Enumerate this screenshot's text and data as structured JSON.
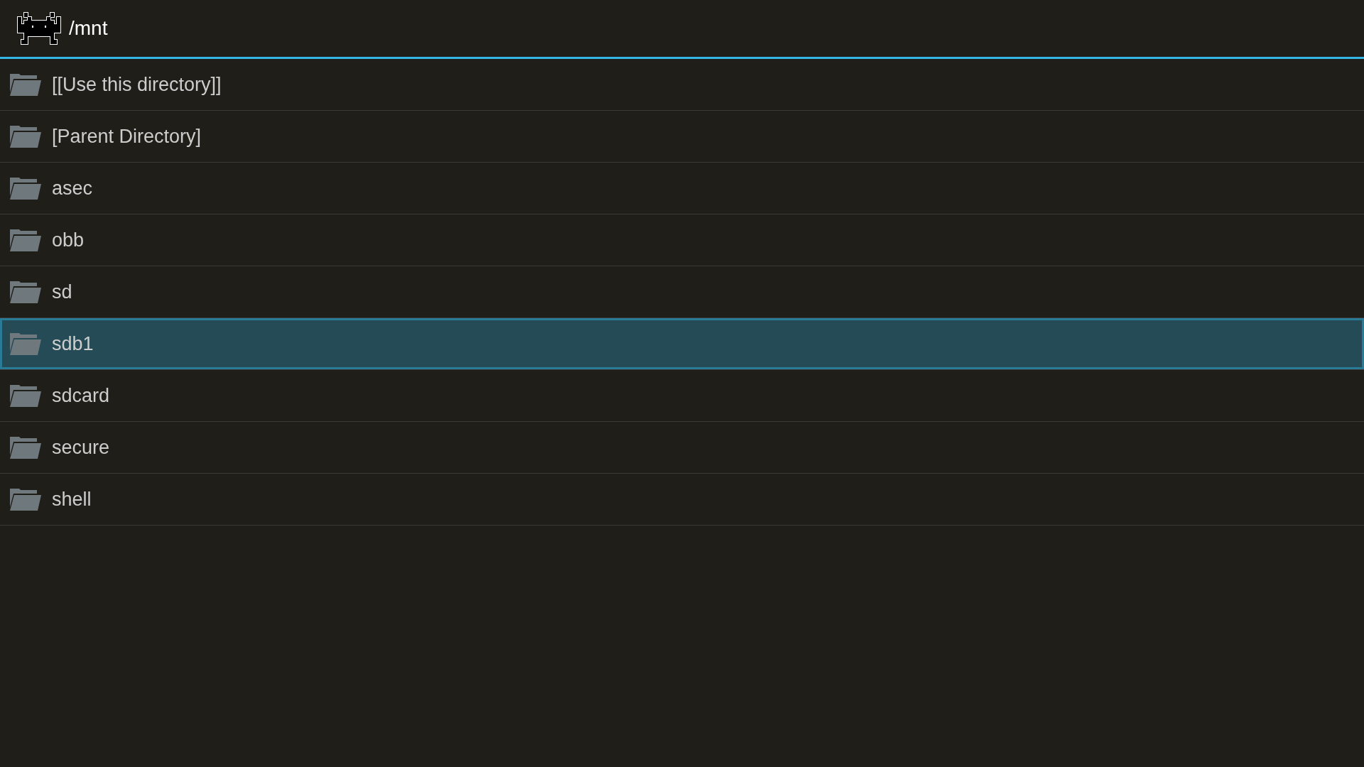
{
  "header": {
    "title": "/mnt"
  },
  "items": [
    {
      "name": "[[Use this directory]]",
      "selected": false
    },
    {
      "name": "[Parent Directory]",
      "selected": false
    },
    {
      "name": "asec",
      "selected": false
    },
    {
      "name": "obb",
      "selected": false
    },
    {
      "name": "sd",
      "selected": false
    },
    {
      "name": "sdb1",
      "selected": true
    },
    {
      "name": "sdcard",
      "selected": false
    },
    {
      "name": "secure",
      "selected": false
    },
    {
      "name": "shell",
      "selected": false
    }
  ]
}
